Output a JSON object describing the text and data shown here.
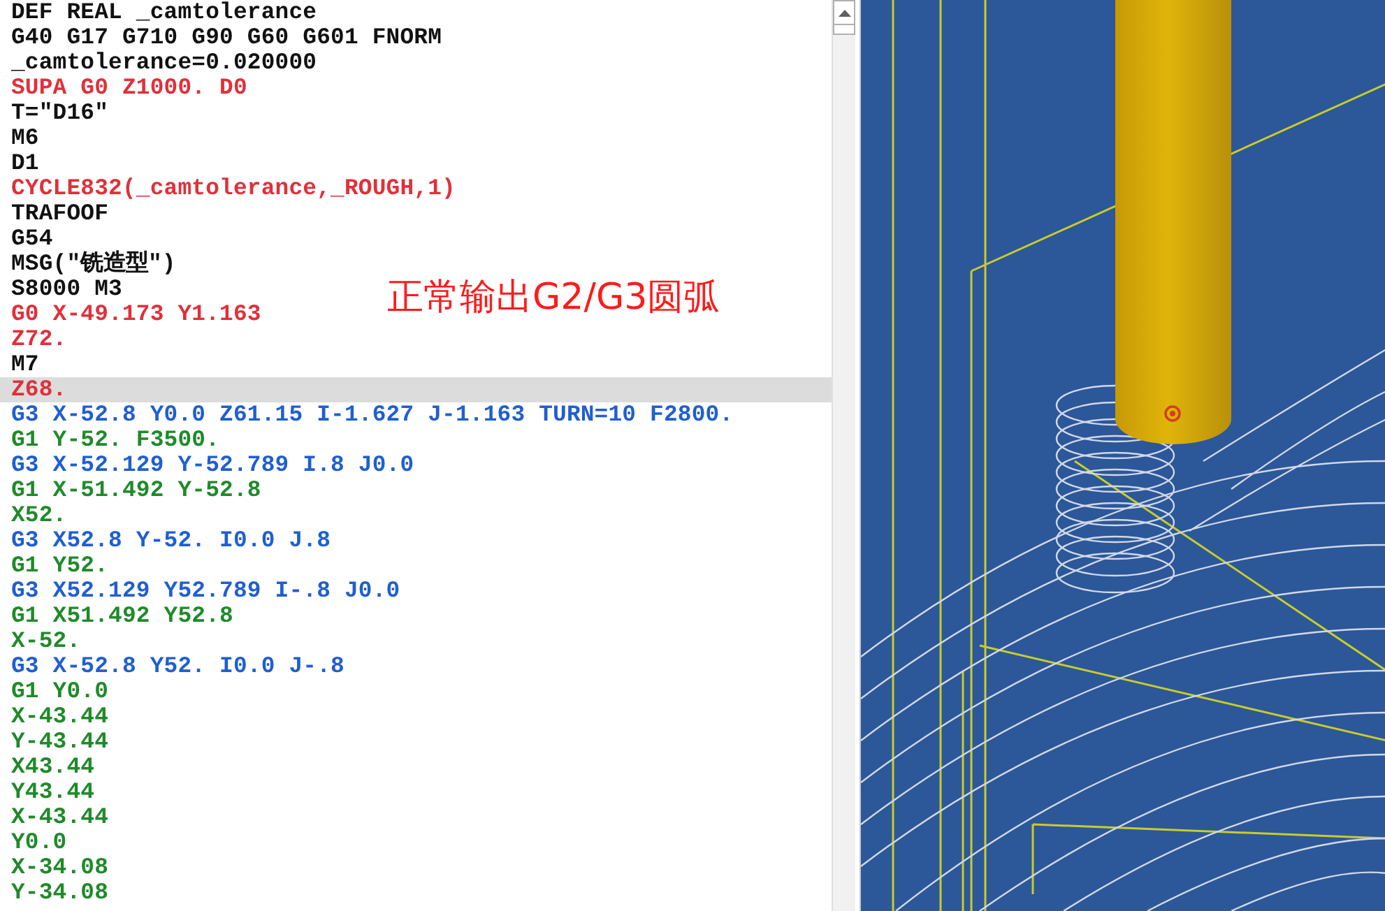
{
  "editor": {
    "lines": [
      {
        "text": "DEF REAL _camtolerance",
        "kind": "plain",
        "selected": false
      },
      {
        "text": "G40 G17 G710 G90 G60 G601 FNORM",
        "kind": "plain",
        "selected": false
      },
      {
        "text": "_camtolerance=0.020000",
        "kind": "plain",
        "selected": false
      },
      {
        "text": "SUPA G0 Z1000. D0",
        "kind": "rapid",
        "selected": false
      },
      {
        "text": "T=\"D16\"",
        "kind": "plain",
        "selected": false
      },
      {
        "text": "M6",
        "kind": "plain",
        "selected": false
      },
      {
        "text": "D1",
        "kind": "plain",
        "selected": false
      },
      {
        "text": "CYCLE832(_camtolerance,_ROUGH,1)",
        "kind": "rapid",
        "selected": false
      },
      {
        "text": "TRAFOOF",
        "kind": "plain",
        "selected": false
      },
      {
        "text": "G54",
        "kind": "plain",
        "selected": false
      },
      {
        "text": "MSG(\"铣造型\")",
        "kind": "plain",
        "selected": false
      },
      {
        "text": "S8000 M3",
        "kind": "plain",
        "selected": false
      },
      {
        "text": "G0 X-49.173 Y1.163",
        "kind": "rapid",
        "selected": false
      },
      {
        "text": "Z72.",
        "kind": "rapid",
        "selected": false
      },
      {
        "text": "M7",
        "kind": "plain",
        "selected": false
      },
      {
        "text": "Z68.",
        "kind": "rapid",
        "selected": true
      },
      {
        "text": "G3 X-52.8 Y0.0 Z61.15 I-1.627 J-1.163 TURN=10 F2800.",
        "kind": "arc",
        "selected": false
      },
      {
        "text": "G1 Y-52. F3500.",
        "kind": "linear",
        "selected": false
      },
      {
        "text": "G3 X-52.129 Y-52.789 I.8 J0.0",
        "kind": "arc",
        "selected": false
      },
      {
        "text": "G1 X-51.492 Y-52.8",
        "kind": "linear",
        "selected": false
      },
      {
        "text": "X52.",
        "kind": "linear",
        "selected": false
      },
      {
        "text": "G3 X52.8 Y-52. I0.0 J.8",
        "kind": "arc",
        "selected": false
      },
      {
        "text": "G1 Y52.",
        "kind": "linear",
        "selected": false
      },
      {
        "text": "G3 X52.129 Y52.789 I-.8 J0.0",
        "kind": "arc",
        "selected": false
      },
      {
        "text": "G1 X51.492 Y52.8",
        "kind": "linear",
        "selected": false
      },
      {
        "text": "X-52.",
        "kind": "linear",
        "selected": false
      },
      {
        "text": "G3 X-52.8 Y52. I0.0 J-.8",
        "kind": "arc",
        "selected": false
      },
      {
        "text": "G1 Y0.0",
        "kind": "linear",
        "selected": false
      },
      {
        "text": "X-43.44",
        "kind": "linear",
        "selected": false
      },
      {
        "text": "Y-43.44",
        "kind": "linear",
        "selected": false
      },
      {
        "text": "X43.44",
        "kind": "linear",
        "selected": false
      },
      {
        "text": "Y43.44",
        "kind": "linear",
        "selected": false
      },
      {
        "text": "X-43.44",
        "kind": "linear",
        "selected": false
      },
      {
        "text": "Y0.0",
        "kind": "linear",
        "selected": false
      },
      {
        "text": "X-34.08",
        "kind": "linear",
        "selected": false
      },
      {
        "text": "Y-34.08",
        "kind": "linear",
        "selected": false
      }
    ]
  },
  "annotation": {
    "text": "正常输出G2/G3圆弧"
  }
}
